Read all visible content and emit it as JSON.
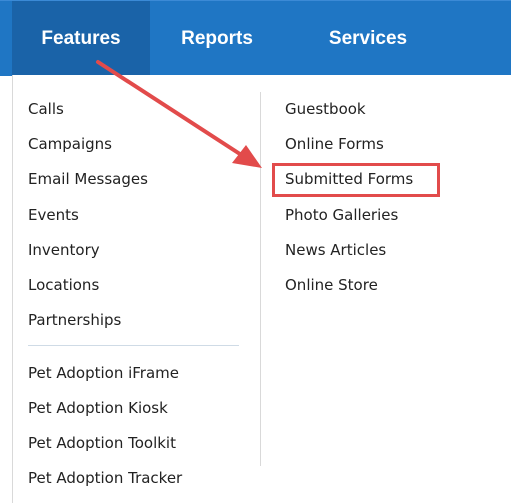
{
  "nav": {
    "tabs": [
      {
        "label": "Features",
        "active": true
      },
      {
        "label": "Reports",
        "active": false
      },
      {
        "label": "Services",
        "active": false
      }
    ]
  },
  "menu": {
    "left_items": [
      "Calls",
      "Campaigns",
      "Email Messages",
      "Events",
      "Inventory",
      "Locations",
      "Partnerships"
    ],
    "left_items_2": [
      "Pet Adoption iFrame",
      "Pet Adoption Kiosk",
      "Pet Adoption Toolkit",
      "Pet Adoption Tracker"
    ],
    "right_items": [
      "Guestbook",
      "Online Forms",
      "Submitted Forms",
      "Photo Galleries",
      "News Articles",
      "Online Store"
    ],
    "highlighted_item": "Submitted Forms"
  },
  "colors": {
    "nav_background": "#1f76c4",
    "annotation_red": "#e24b4b"
  }
}
